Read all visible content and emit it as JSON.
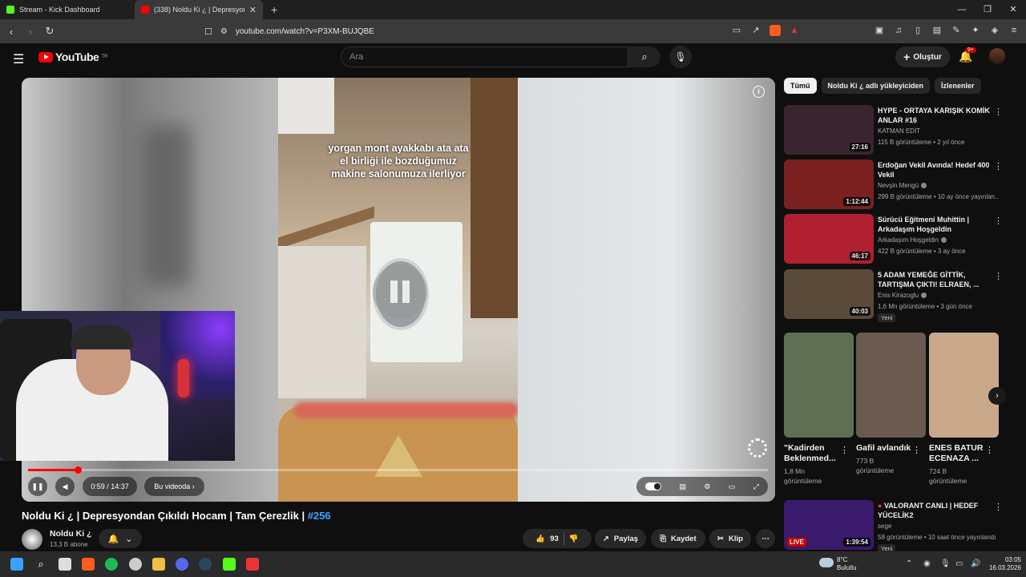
{
  "browser": {
    "tabs": [
      {
        "label": "Stream - Kick Dashboard",
        "active": false
      },
      {
        "label": "(338) Noldu Ki ¿ | Depresyon",
        "active": true
      }
    ],
    "url": "youtube.com/watch?v=P3XM-BUJQBE"
  },
  "header": {
    "logo_text": "YouTube",
    "logo_region": "TR",
    "search_placeholder": "Ara",
    "create_label": "Oluştur",
    "notification_count": "9+"
  },
  "player": {
    "caption": "yorgan mont ayakkabı ata ata el birliği ile bozduğumuz makine salonumuza ilerliyor",
    "time": "0:59 / 14:37",
    "chapter_label": "Bu videoda",
    "progress_percent": 6.7
  },
  "video": {
    "title": "Noldu Ki ¿ | Depresyondan Çıkıldı Hocam | Tam Çerezlik |",
    "hashtag": "#256",
    "channel_name": "Noldu Ki ¿",
    "subscribers": "13,3 B abone",
    "likes": "93",
    "share_label": "Paylaş",
    "save_label": "Kaydet",
    "clip_label": "Klip"
  },
  "sidebar": {
    "chips": [
      "Tümü",
      "Noldu Ki ¿ adlı yükleyiciden",
      "İzlenenler"
    ],
    "recommendations": [
      {
        "title": "HYPE - ORTAYA KARIŞIK KOMİK ANLAR #16",
        "channel": "KATMAN EDİT",
        "verified": false,
        "meta": "115 B görüntüleme • 2 yıl önce",
        "duration": "27:16",
        "thumb": "#3a2430"
      },
      {
        "title": "Erdoğan Vekil Avında! Hedef 400 Vekil",
        "channel": "Nevşin Mengü",
        "verified": true,
        "meta": "299 B görüntüleme • 10 ay önce yayınlan...",
        "duration": "1:12:44",
        "thumb": "#7a2020"
      },
      {
        "title": "Sürücü Eğitmeni Muhittin | Arkadaşım Hoşgeldin",
        "channel": "Arkadaşım Hoşgeldin",
        "verified": true,
        "meta": "422 B görüntüleme • 3 ay önce",
        "duration": "46:17",
        "thumb": "#b02030"
      },
      {
        "title": "5 ADAM YEMEĞE GİTTİK, TARTIŞMA ÇIKTI! ELRAEN, ...",
        "channel": "Enis Kirazoglu",
        "verified": true,
        "meta": "1,6 Mn görüntüleme • 3 gün önce",
        "duration": "40:03",
        "thumb": "#5a4a3a",
        "badge": "Yeni"
      }
    ],
    "shorts": [
      {
        "title": "\"Kadirden Beklenmed...",
        "views": "1,8 Mn görüntüleme",
        "thumb": "#5e6f54"
      },
      {
        "title": "Gafil avlandık",
        "views": "773 B görüntüleme",
        "thumb": "#6a5a50"
      },
      {
        "title": "ENES BATUR ECENAZA ...",
        "views": "724 B görüntüleme",
        "thumb": "#c9a88a"
      }
    ],
    "live": {
      "title": "VALORANT CANLI | HEDEF YÜCELİK2",
      "channel": "sege",
      "meta": "58 görüntüleme • 10 saat önce yayınlandı",
      "duration": "1:39:54",
      "live_label": "LIVE",
      "badge": "Yeni",
      "thumb": "#3a1a6a"
    }
  },
  "taskbar": {
    "weather_temp": "8°C",
    "weather_desc": "Bulutlu",
    "time": "03:05",
    "date": "16.03.2026"
  }
}
